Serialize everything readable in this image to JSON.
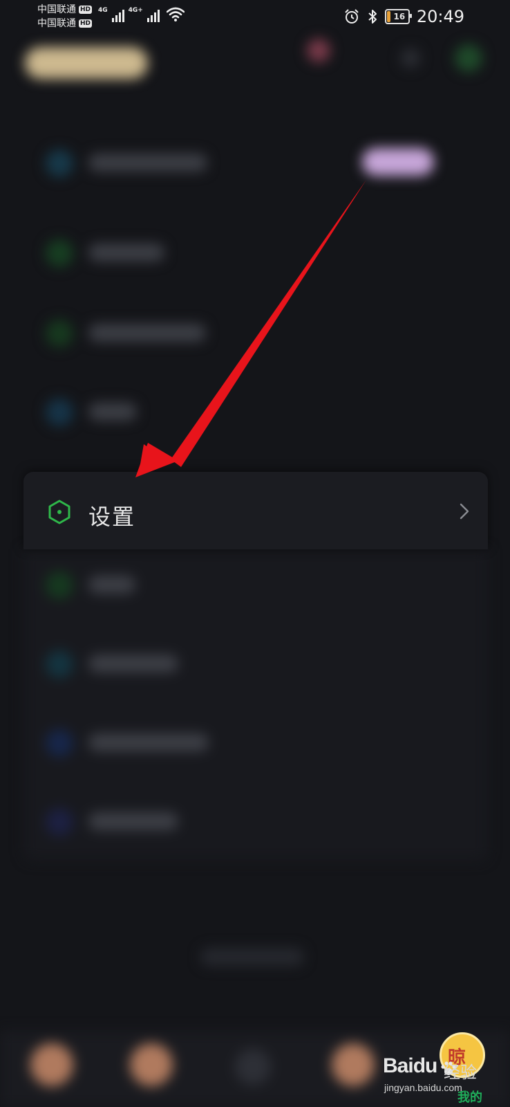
{
  "status_bar": {
    "carrier_1": "中国联通",
    "carrier_2": "中国联通",
    "hd_label": "HD",
    "network_1": "4G",
    "network_2": "4G+",
    "battery_percent": "16",
    "time": "20:49",
    "icons": [
      "alarm-icon",
      "bluetooth-icon",
      "battery-icon",
      "wifi-icon",
      "signal-icon"
    ]
  },
  "menu": {
    "settings_label": "设置",
    "settings_icon": "hexagon-settings-icon",
    "accent_color": "#2fb84a"
  },
  "annotation": {
    "arrow_color": "#e8141b"
  },
  "watermark": {
    "brand": "Bai",
    "brand_du": "du",
    "jingyan": "经验",
    "url": "jingyan.baidu.com",
    "badge_text": "晾",
    "wode": "我的"
  }
}
